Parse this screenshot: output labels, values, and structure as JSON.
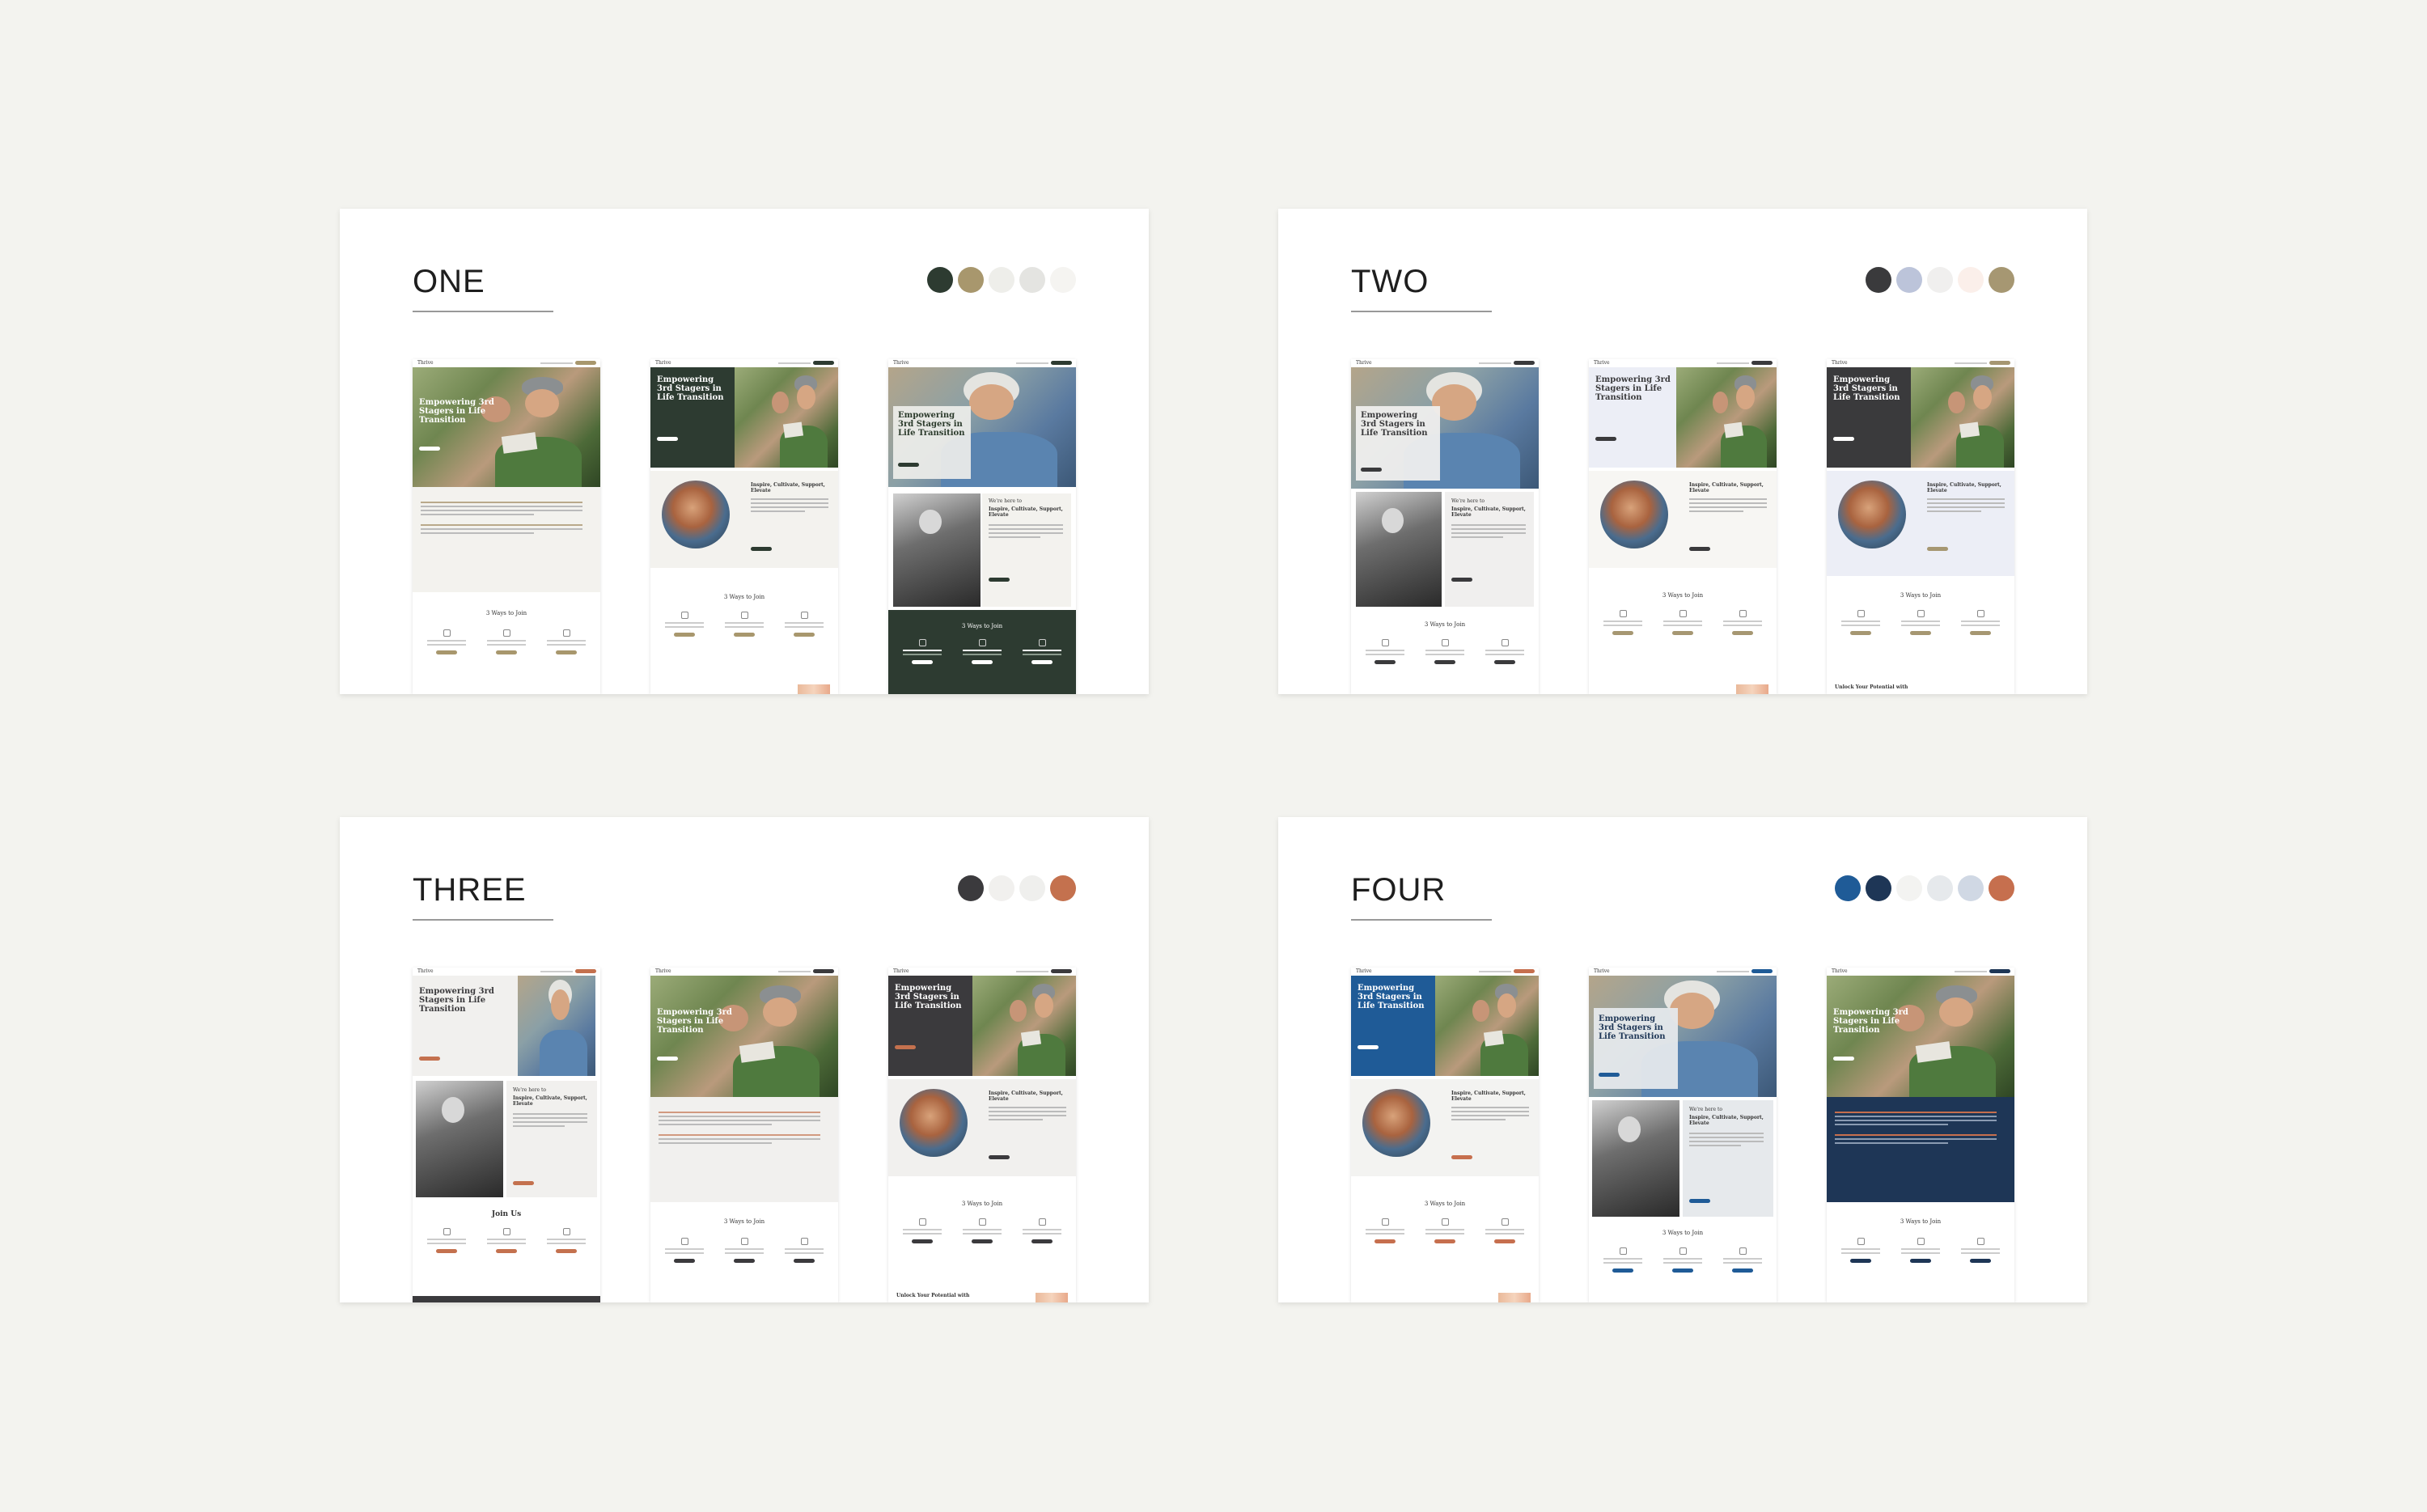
{
  "options": [
    {
      "title": "ONE",
      "swatches": [
        "#2d3b31",
        "#a8976d",
        "#eeeeea",
        "#e4e4e1",
        "#f5f4f1"
      ]
    },
    {
      "title": "TWO",
      "swatches": [
        "#3a3a3c",
        "#bcc4da",
        "#f0efee",
        "#fbefea",
        "#a69772"
      ]
    },
    {
      "title": "THREE",
      "swatches": [
        "#3b3a3d",
        "#f1f0ee",
        "#efefed",
        "#c4714e"
      ]
    },
    {
      "title": "FOUR",
      "swatches": [
        "#1f5b97",
        "#1e3656",
        "#f3f3f1",
        "#e6e9ec",
        "#d0d8e4",
        "#c66f4e"
      ]
    }
  ],
  "mockup": {
    "logo": "Thrive",
    "hero_heading": "Empowering 3rd Stagers in Life Transition",
    "hero_heading_alt": "Empowering 3rd Stagers in Life Transition",
    "tagline": "Inspire, Cultivate, Support, Elevate",
    "we_are_here": "We're here to",
    "join_heading": "3 Ways to Join",
    "join_heading_alt": "Join Us",
    "unlock": "Unlock Your Potential with"
  }
}
